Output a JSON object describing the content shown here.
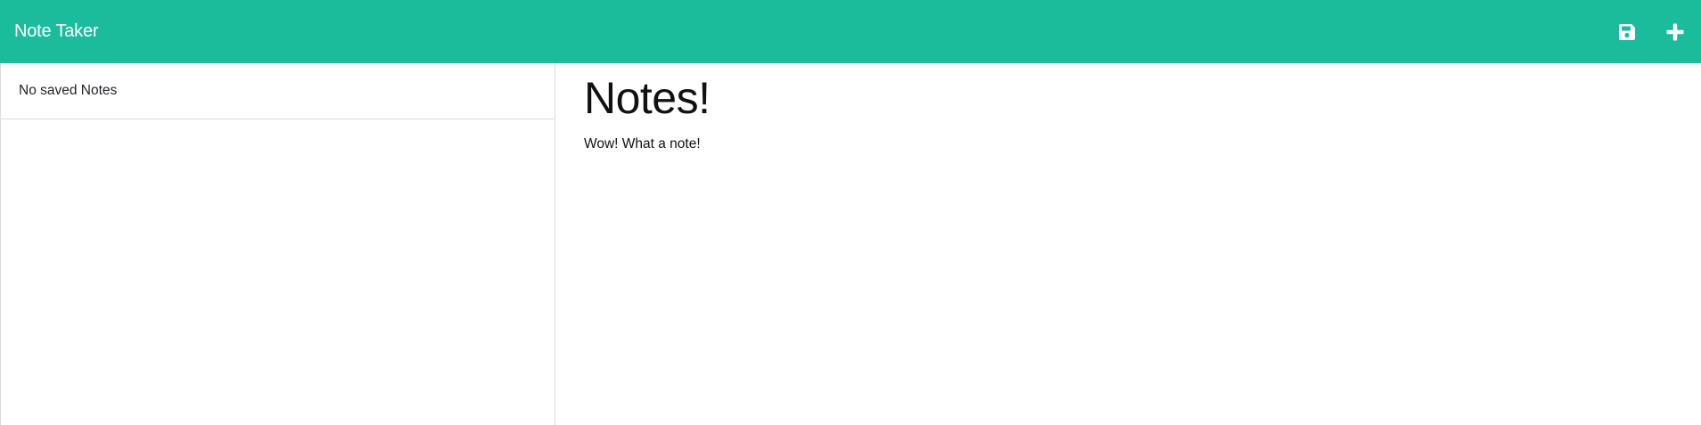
{
  "app": {
    "title": "Note Taker"
  },
  "toolbar": {
    "icons": [
      "save-icon",
      "plus-icon"
    ]
  },
  "sidebar": {
    "items": [
      {
        "label": "No saved Notes"
      }
    ]
  },
  "note": {
    "title": "Notes!",
    "text": "Wow! What a note!"
  },
  "colors": {
    "navbar": "#1abc9c",
    "border": "#dcdcdc"
  }
}
